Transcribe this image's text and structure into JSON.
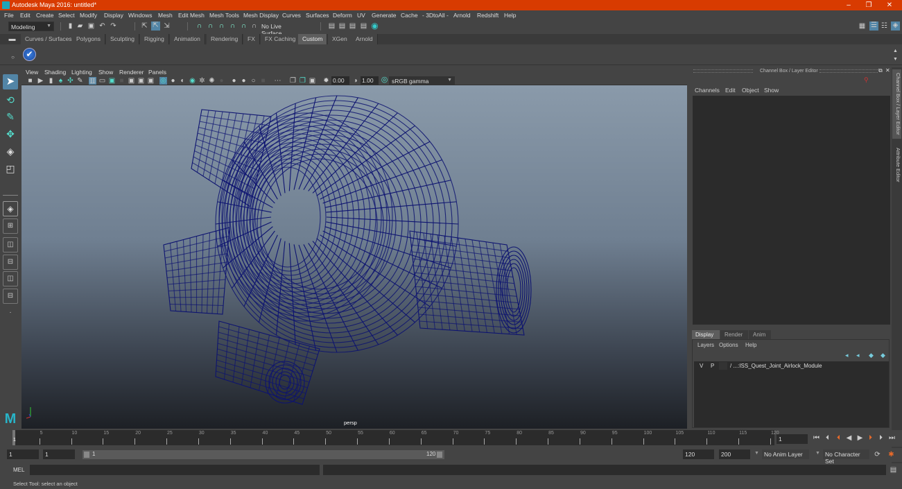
{
  "window": {
    "title": "Autodesk Maya 2016: untitled*",
    "controls": {
      "minimize": "–",
      "restore": "❐",
      "close": "✕"
    }
  },
  "menubar": [
    "File",
    "Edit",
    "Create",
    "Select",
    "Modify",
    "Display",
    "Windows",
    "Mesh",
    "Edit Mesh",
    "Mesh Tools",
    "Mesh Display",
    "Curves",
    "Surfaces",
    "Deform",
    "UV",
    "Generate",
    "Cache",
    "- 3DtoAll -",
    "Arnold",
    "Redshift",
    "Help"
  ],
  "statusline": {
    "menuset": "Modeling",
    "live_surface": "No Live Surface"
  },
  "shelf": {
    "tabs": [
      "Curves / Surfaces",
      "Polygons",
      "Sculpting",
      "Rigging",
      "Animation",
      "Rendering",
      "FX",
      "FX Caching",
      "Custom",
      "XGen",
      "Arnold"
    ],
    "active_tab": "Custom"
  },
  "viewport": {
    "menu": [
      "View",
      "Shading",
      "Lighting",
      "Show",
      "Renderer",
      "Panels"
    ],
    "exposure": "0.00",
    "gamma": "1.00",
    "color_space": "sRGB gamma",
    "camera_label": "persp",
    "wire_color": "#0d1370"
  },
  "channel_box": {
    "header": "Channel Box / Layer Editor",
    "menu": [
      "Channels",
      "Edit",
      "Object",
      "Show"
    ],
    "layer_tabs": [
      "Display",
      "Render",
      "Anim"
    ],
    "active_layer_tab": "Display",
    "layer_menu": [
      "Layers",
      "Options",
      "Help"
    ],
    "layers": [
      {
        "visible": "V",
        "playback": "P",
        "name": "/ ...:ISS_Quest_Joint_Airlock_Module"
      }
    ]
  },
  "side_tabs": [
    "Channel Box / Layer Editor",
    "Attribute Editor"
  ],
  "timeline": {
    "ticks": [
      "5",
      "10",
      "15",
      "20",
      "25",
      "30",
      "35",
      "40",
      "45",
      "50",
      "55",
      "60",
      "65",
      "70",
      "75",
      "80",
      "85",
      "90",
      "95",
      "100",
      "105",
      "110",
      "115",
      "120"
    ],
    "current_frame_marker": "1",
    "current_frame": "1",
    "start": 1,
    "end": 120
  },
  "range": {
    "start_field": "1",
    "playback_start": "1",
    "slider_start": "1",
    "slider_end": "120",
    "playback_end": "120",
    "end_field": "200",
    "anim_layer": "No Anim Layer",
    "character_set": "No Character Set"
  },
  "command_line": {
    "label": "MEL",
    "value": ""
  },
  "help_line": "Select Tool: select an object"
}
